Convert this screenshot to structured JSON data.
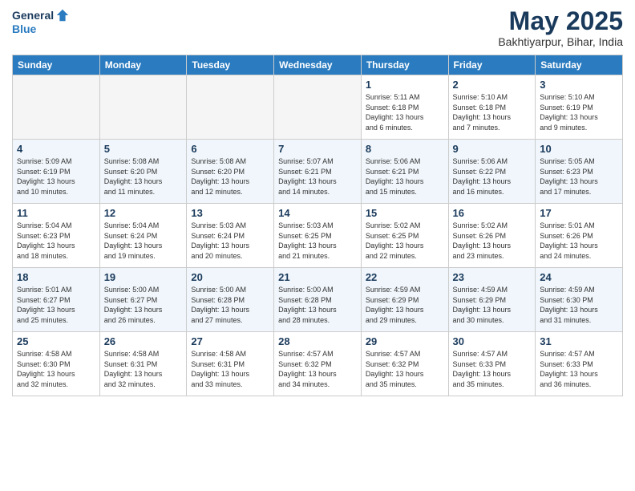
{
  "header": {
    "logo_general": "General",
    "logo_blue": "Blue",
    "month_title": "May 2025",
    "location": "Bakhtiyarpur, Bihar, India"
  },
  "weekdays": [
    "Sunday",
    "Monday",
    "Tuesday",
    "Wednesday",
    "Thursday",
    "Friday",
    "Saturday"
  ],
  "weeks": [
    [
      {
        "day": "",
        "info": ""
      },
      {
        "day": "",
        "info": ""
      },
      {
        "day": "",
        "info": ""
      },
      {
        "day": "",
        "info": ""
      },
      {
        "day": "1",
        "info": "Sunrise: 5:11 AM\nSunset: 6:18 PM\nDaylight: 13 hours\nand 6 minutes."
      },
      {
        "day": "2",
        "info": "Sunrise: 5:10 AM\nSunset: 6:18 PM\nDaylight: 13 hours\nand 7 minutes."
      },
      {
        "day": "3",
        "info": "Sunrise: 5:10 AM\nSunset: 6:19 PM\nDaylight: 13 hours\nand 9 minutes."
      }
    ],
    [
      {
        "day": "4",
        "info": "Sunrise: 5:09 AM\nSunset: 6:19 PM\nDaylight: 13 hours\nand 10 minutes."
      },
      {
        "day": "5",
        "info": "Sunrise: 5:08 AM\nSunset: 6:20 PM\nDaylight: 13 hours\nand 11 minutes."
      },
      {
        "day": "6",
        "info": "Sunrise: 5:08 AM\nSunset: 6:20 PM\nDaylight: 13 hours\nand 12 minutes."
      },
      {
        "day": "7",
        "info": "Sunrise: 5:07 AM\nSunset: 6:21 PM\nDaylight: 13 hours\nand 14 minutes."
      },
      {
        "day": "8",
        "info": "Sunrise: 5:06 AM\nSunset: 6:21 PM\nDaylight: 13 hours\nand 15 minutes."
      },
      {
        "day": "9",
        "info": "Sunrise: 5:06 AM\nSunset: 6:22 PM\nDaylight: 13 hours\nand 16 minutes."
      },
      {
        "day": "10",
        "info": "Sunrise: 5:05 AM\nSunset: 6:23 PM\nDaylight: 13 hours\nand 17 minutes."
      }
    ],
    [
      {
        "day": "11",
        "info": "Sunrise: 5:04 AM\nSunset: 6:23 PM\nDaylight: 13 hours\nand 18 minutes."
      },
      {
        "day": "12",
        "info": "Sunrise: 5:04 AM\nSunset: 6:24 PM\nDaylight: 13 hours\nand 19 minutes."
      },
      {
        "day": "13",
        "info": "Sunrise: 5:03 AM\nSunset: 6:24 PM\nDaylight: 13 hours\nand 20 minutes."
      },
      {
        "day": "14",
        "info": "Sunrise: 5:03 AM\nSunset: 6:25 PM\nDaylight: 13 hours\nand 21 minutes."
      },
      {
        "day": "15",
        "info": "Sunrise: 5:02 AM\nSunset: 6:25 PM\nDaylight: 13 hours\nand 22 minutes."
      },
      {
        "day": "16",
        "info": "Sunrise: 5:02 AM\nSunset: 6:26 PM\nDaylight: 13 hours\nand 23 minutes."
      },
      {
        "day": "17",
        "info": "Sunrise: 5:01 AM\nSunset: 6:26 PM\nDaylight: 13 hours\nand 24 minutes."
      }
    ],
    [
      {
        "day": "18",
        "info": "Sunrise: 5:01 AM\nSunset: 6:27 PM\nDaylight: 13 hours\nand 25 minutes."
      },
      {
        "day": "19",
        "info": "Sunrise: 5:00 AM\nSunset: 6:27 PM\nDaylight: 13 hours\nand 26 minutes."
      },
      {
        "day": "20",
        "info": "Sunrise: 5:00 AM\nSunset: 6:28 PM\nDaylight: 13 hours\nand 27 minutes."
      },
      {
        "day": "21",
        "info": "Sunrise: 5:00 AM\nSunset: 6:28 PM\nDaylight: 13 hours\nand 28 minutes."
      },
      {
        "day": "22",
        "info": "Sunrise: 4:59 AM\nSunset: 6:29 PM\nDaylight: 13 hours\nand 29 minutes."
      },
      {
        "day": "23",
        "info": "Sunrise: 4:59 AM\nSunset: 6:29 PM\nDaylight: 13 hours\nand 30 minutes."
      },
      {
        "day": "24",
        "info": "Sunrise: 4:59 AM\nSunset: 6:30 PM\nDaylight: 13 hours\nand 31 minutes."
      }
    ],
    [
      {
        "day": "25",
        "info": "Sunrise: 4:58 AM\nSunset: 6:30 PM\nDaylight: 13 hours\nand 32 minutes."
      },
      {
        "day": "26",
        "info": "Sunrise: 4:58 AM\nSunset: 6:31 PM\nDaylight: 13 hours\nand 32 minutes."
      },
      {
        "day": "27",
        "info": "Sunrise: 4:58 AM\nSunset: 6:31 PM\nDaylight: 13 hours\nand 33 minutes."
      },
      {
        "day": "28",
        "info": "Sunrise: 4:57 AM\nSunset: 6:32 PM\nDaylight: 13 hours\nand 34 minutes."
      },
      {
        "day": "29",
        "info": "Sunrise: 4:57 AM\nSunset: 6:32 PM\nDaylight: 13 hours\nand 35 minutes."
      },
      {
        "day": "30",
        "info": "Sunrise: 4:57 AM\nSunset: 6:33 PM\nDaylight: 13 hours\nand 35 minutes."
      },
      {
        "day": "31",
        "info": "Sunrise: 4:57 AM\nSunset: 6:33 PM\nDaylight: 13 hours\nand 36 minutes."
      }
    ]
  ]
}
